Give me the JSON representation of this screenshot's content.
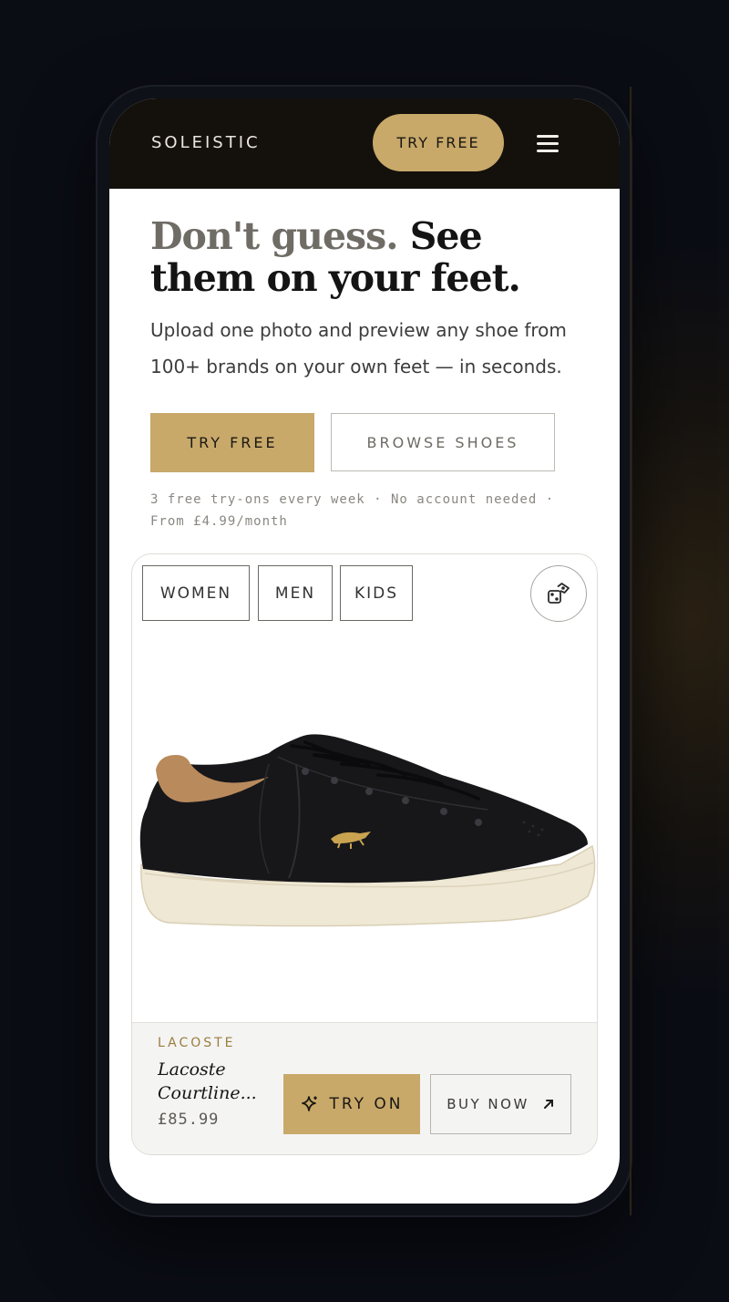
{
  "header": {
    "brand": "SOLEISTIC",
    "cta_label": "TRY FREE",
    "menu_icon": "hamburger-menu-icon"
  },
  "hero": {
    "headline_muted": "Don't guess.",
    "headline_strong": " See them on your feet.",
    "subtext": "Upload one photo and preview any shoe from 100+ brands on your own feet — in seconds.",
    "primary_button": "TRY FREE",
    "secondary_button": "BROWSE SHOES",
    "fineprint": "3 free try-ons every week · No account needed · From £4.99/month"
  },
  "card": {
    "tabs": [
      {
        "label": "WOMEN"
      },
      {
        "label": "MEN"
      },
      {
        "label": "KIDS"
      }
    ],
    "shuffle_icon": "dice-icon",
    "product": {
      "brand": "LACOSTE",
      "name_line1": "Lacoste",
      "name_line2": "Courtline...",
      "price": "£85.99",
      "try_on_label": "TRY ON",
      "try_on_icon": "sparkle-icon",
      "buy_label": "BUY NOW",
      "buy_icon": "arrow-up-right-icon"
    }
  },
  "colors": {
    "accent_gold": "#c8a96a",
    "header_bg": "#14110d",
    "page_bg": "#0b0d15"
  }
}
